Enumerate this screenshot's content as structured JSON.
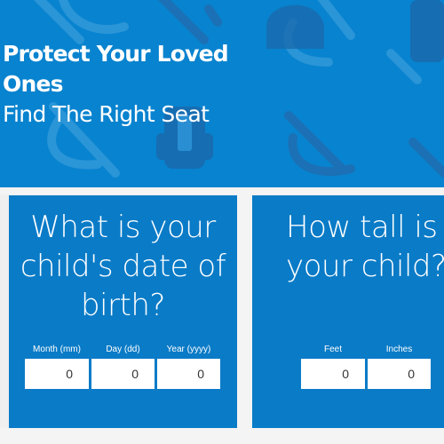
{
  "hero": {
    "title": "Protect Your Loved Ones",
    "subtitle": "Find The Right Seat",
    "background_color": "#0883cf",
    "decor_icons": [
      "car-seat-icon",
      "booster-seat-icon",
      "harness-seat-icon"
    ]
  },
  "dob_card": {
    "question": "What is your child's date of birth?",
    "fields": [
      {
        "label": "Month (mm)",
        "value": "0"
      },
      {
        "label": "Day (dd)",
        "value": "0"
      },
      {
        "label": "Year (yyyy)",
        "value": "0"
      }
    ]
  },
  "height_card": {
    "question": "How tall is your child?",
    "fields": [
      {
        "label": "Feet",
        "value": "0"
      },
      {
        "label": "Inches",
        "value": "0"
      }
    ]
  },
  "colors": {
    "card_blue": "#0a7bc7",
    "hero_blue": "#0883cf",
    "page_bg": "#f4f4f4"
  }
}
